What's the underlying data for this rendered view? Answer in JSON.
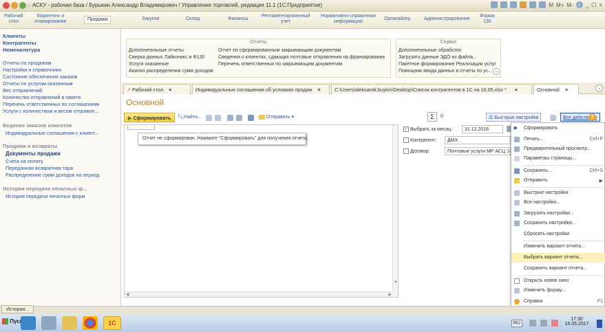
{
  "window": {
    "title": "АСКУ - рабочая база / Бурыкин Александр Владимирович / Управление торговлей, редакция 11.1 (1С:Предприятие)",
    "toolbar_labels": [
      "M",
      "M+",
      "M-",
      "i",
      "_",
      "☐",
      "×"
    ]
  },
  "sections": [
    {
      "line1": "Рабочий",
      "line2": "стол"
    },
    {
      "line1": "Маркетинг и",
      "line2": "планирование"
    },
    {
      "line1": "Продажи",
      "line2": ""
    },
    {
      "line1": "Закупки",
      "line2": ""
    },
    {
      "line1": "Склад",
      "line2": ""
    },
    {
      "line1": "Финансы",
      "line2": ""
    },
    {
      "line1": "Регламентированный",
      "line2": "учет"
    },
    {
      "line1": "Нормативно-справочная",
      "line2": "информация"
    },
    {
      "line1": "Органайзер",
      "line2": ""
    },
    {
      "line1": "Администрирование",
      "line2": ""
    },
    {
      "line1": "Форма",
      "line2": "130"
    }
  ],
  "left_panel": {
    "top_links": [
      "Клиенты",
      "Контрагенты",
      "Номенклатура"
    ],
    "reports": [
      "Отчеты по продажам",
      "Настройки и справочники",
      "Состояние обеспечения заказов",
      "Отчеты по услугам оказанным",
      "Вес отправлений",
      "Количество отправлений в пакете",
      "Перечень ответственных по соглашениям",
      "Услуги с количеством и весом отправле..."
    ],
    "group1": {
      "title": "Ведение заказов клиентов",
      "items": [
        "Индивидуальные соглашения с клиент..."
      ]
    },
    "group2": {
      "title": "Продажи и возвраты",
      "items": [
        "Документы продажи",
        "Счета на оплату",
        "Переданная возвратная тара",
        "Распределение сумм доходов на период"
      ]
    },
    "group3": {
      "title": "История передачи печатных ф...",
      "items": [
        "История передачи печатных форм"
      ]
    }
  },
  "commands": {
    "reports_header": "Отчеты",
    "service_header": "Сервис",
    "col1": [
      "Дополнительные отчеты",
      "Сверка данных Лайконикс и Ф130",
      "Услуги оказанные",
      "Анализ распределения сумм доходов"
    ],
    "col2": [
      "Отчет по сформированным закрывающим документам",
      "Сведения о клиентах, сдающих почтовые отправления на франкирование",
      "Перечень ответственных по закрывающим документам"
    ],
    "col3": [
      "Дополнительные обработки",
      "Загрузить данные ЭДО из файла...",
      "Пакетное формирование Реализации услуг",
      "Помощник ввода данных в отчеты по ус..."
    ]
  },
  "tabs": [
    {
      "label": "Рабочий стол"
    },
    {
      "label": "Индивидуальные соглашения об условиях продаж"
    },
    {
      "label": "C:\\Users\\aleksandr.buykin\\Desktop\\Список контрагентов в 1С на 16.05.xlsx *"
    },
    {
      "label": "Основной"
    }
  ],
  "form": {
    "title": "Основной",
    "generate_button": "Сформировать",
    "find_label": "Найти...",
    "send_label": "Отправить",
    "sum_value": "0",
    "quick_settings": "Быстрые настройки",
    "all_actions": "Все действия",
    "message": "Отчет не сформирован. Нажмите \"Сформировать\" для получения отчета."
  },
  "settings": {
    "month_label": "Выбрать за месяц:",
    "month_value": "31.12.2016",
    "counterparty_label": "Контрагент:",
    "counterparty_value": "ДМХ",
    "contract_label": "Договор:",
    "contract_value": "Почтовые услуги МР АСЦ 140"
  },
  "menu": [
    {
      "label": "Сформировать",
      "shortcut": "",
      "highlight": false
    },
    {
      "label": "Печать...",
      "shortcut": "Ctrl+P",
      "highlight": false
    },
    {
      "label": "Предварительный просмотр...",
      "shortcut": "",
      "highlight": false
    },
    {
      "label": "Параметры страницы...",
      "shortcut": "",
      "highlight": false
    },
    {
      "label": "Сохранить...",
      "shortcut": "Ctrl+S",
      "highlight": false
    },
    {
      "label": "Отправить",
      "shortcut": "▶",
      "highlight": false
    },
    {
      "label": "Быстрые настройки",
      "shortcut": "",
      "highlight": false
    },
    {
      "label": "Все настройки...",
      "shortcut": "",
      "highlight": false
    },
    {
      "label": "Загрузить настройки...",
      "shortcut": "",
      "highlight": false
    },
    {
      "label": "Сохранить настройки...",
      "shortcut": "",
      "highlight": false
    },
    {
      "label": "Сбросить настройки",
      "shortcut": "",
      "highlight": false
    },
    {
      "label": "Изменить вариант отчета...",
      "shortcut": "",
      "highlight": false
    },
    {
      "label": "Выбрать вариант отчета...",
      "shortcut": "",
      "highlight": true
    },
    {
      "label": "Сохранить вариант отчета...",
      "shortcut": "",
      "highlight": false
    },
    {
      "label": "Открыть новое окно",
      "shortcut": "",
      "highlight": false
    },
    {
      "label": "Изменить форму...",
      "shortcut": "",
      "highlight": false
    },
    {
      "label": "Справка",
      "shortcut": "F1",
      "highlight": false
    }
  ],
  "history_button": "История...",
  "taskbar": {
    "start": "Пуск",
    "lang": "RU",
    "time": "17:30",
    "date": "16.05.2017"
  },
  "colors": {
    "accent_orange": "#c77b1f",
    "link_blue": "#2c54a0",
    "highlight": "#fbf0b8",
    "generate_yellow": "#f3cd3f"
  }
}
